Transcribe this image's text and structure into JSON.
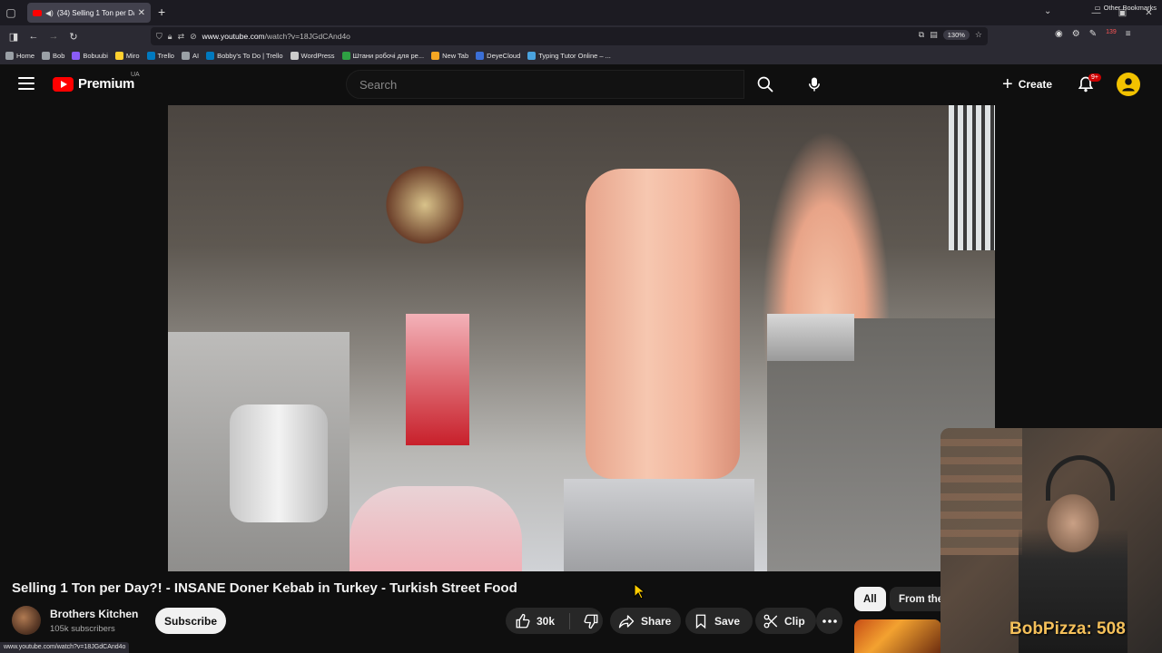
{
  "browser": {
    "tab_title": "(34) Selling 1 Ton per Day?!",
    "url_host": "www.youtube.com",
    "url_path": "/watch?v=18JGdCAnd4o",
    "zoom": "130%",
    "extension_badge": "139",
    "status_url": "www.youtube.com/watch?v=18JGdCAnd4o",
    "bookmarks": [
      {
        "label": "Home",
        "color": "#9aa0a6"
      },
      {
        "label": "Bob",
        "color": "#9aa0a6"
      },
      {
        "label": "Bobuubi",
        "color": "#8a5cf6"
      },
      {
        "label": "Miro",
        "color": "#ffd02f"
      },
      {
        "label": "Trello",
        "color": "#0079bf"
      },
      {
        "label": "AI",
        "color": "#9aa0a6"
      },
      {
        "label": "Bobby's To Do | Trello",
        "color": "#0079bf"
      },
      {
        "label": "WordPress",
        "color": "#cccccc"
      },
      {
        "label": "Штани робочі для ре...",
        "color": "#2ea043"
      },
      {
        "label": "New Tab",
        "color": "#f5a623"
      },
      {
        "label": "DeyeCloud",
        "color": "#3b6fd6"
      },
      {
        "label": "Typing Tutor Online – ...",
        "color": "#4aa3df"
      }
    ],
    "other_bookmarks": "Other Bookmarks"
  },
  "masthead": {
    "logo_text": "Premium",
    "region": "UA",
    "search_placeholder": "Search",
    "create_label": "Create",
    "notification_count": "9+"
  },
  "video": {
    "title": "Selling 1 Ton per Day?! - INSANE Doner Kebab in Turkey - Turkish Street Food",
    "channel_name": "Brothers Kitchen",
    "subscribers": "105k subscribers",
    "subscribe_label": "Subscribe",
    "likes": "30k",
    "share_label": "Share",
    "save_label": "Save",
    "clip_label": "Clip"
  },
  "chips": {
    "all": "All",
    "from_the": "From the"
  },
  "overlay": {
    "counter": "BobPizza: 508"
  },
  "colors": {
    "accent_red": "#ff0000",
    "background": "#0f0f0f",
    "counter_text": "#f5c05a"
  }
}
